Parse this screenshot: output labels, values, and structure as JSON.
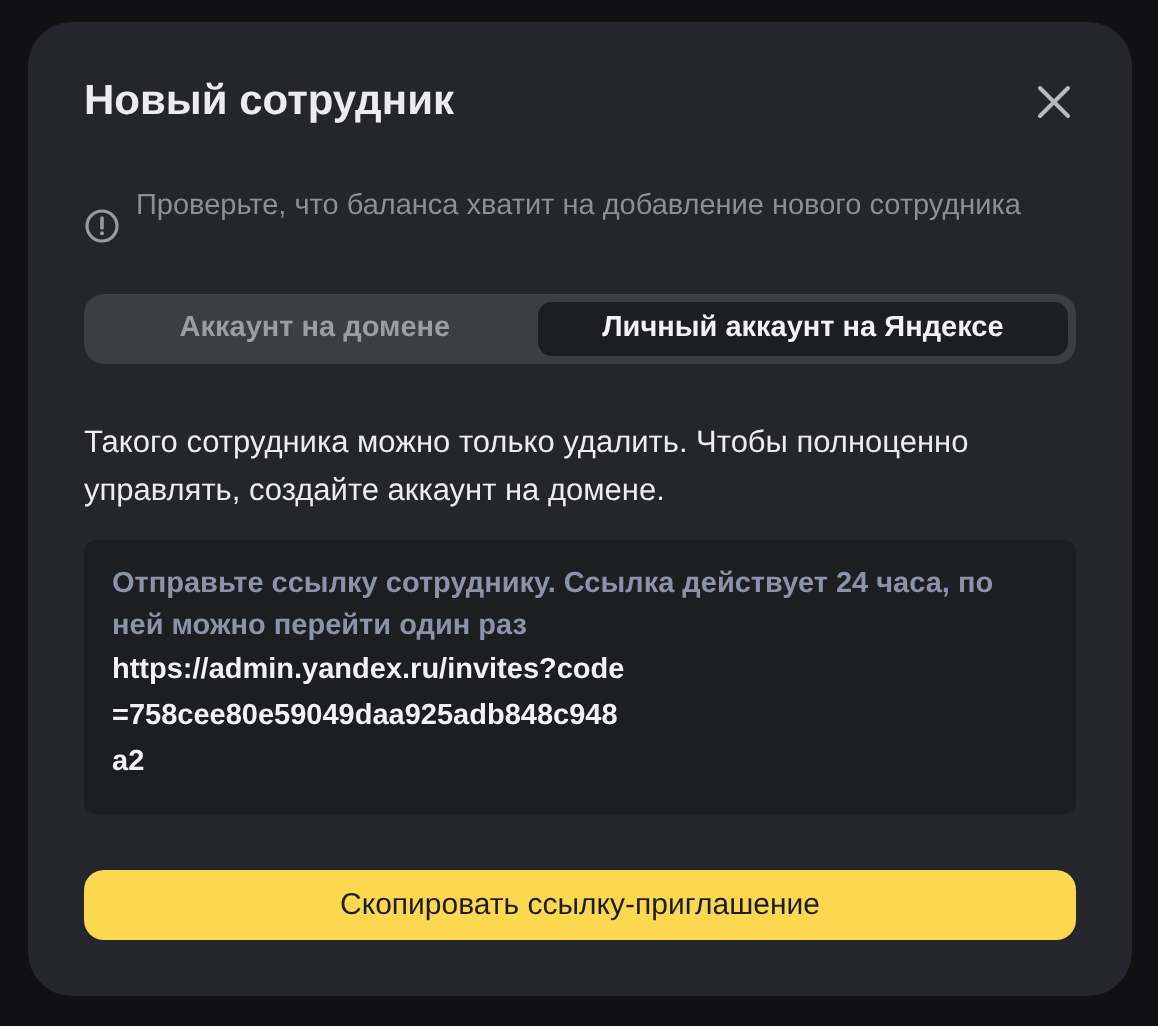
{
  "dialog": {
    "title": "Новый сотрудник"
  },
  "notice": "Проверьте, что баланса хватит на добавление нового сотрудника",
  "tabs": [
    {
      "label": "Аккаунт на домене",
      "selected": false
    },
    {
      "label": "Личный аккаунт на Яндексе",
      "selected": true
    }
  ],
  "description": "Такого сотрудника можно только удалить. Чтобы полноценно управлять, создайте аккаунт на домене.",
  "invite": {
    "hint": "Отправьте ссылку сотруднику. Ссылка действует 24 часа, по ней можно перейти один раз",
    "link": "https://admin.yandex.ru/invites?code=758cee80e59049daa925adb848c948a2"
  },
  "button": "Скопировать ссылку-приглашение"
}
